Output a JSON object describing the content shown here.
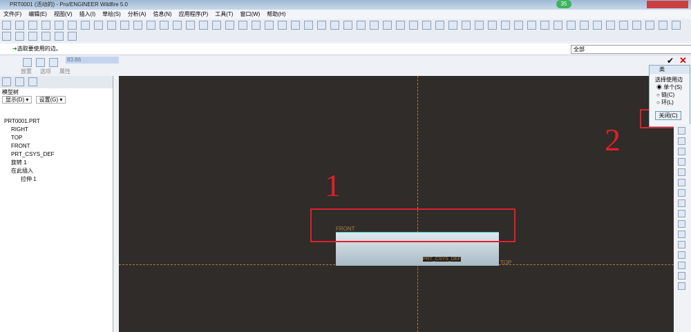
{
  "title": "PRT0001 (活动的) - Pro/ENGINEER Wildfire 5.0",
  "menu": [
    "文件(F)",
    "编辑(E)",
    "视图(V)",
    "插入(I)",
    "草绘(S)",
    "分析(A)",
    "信息(N)",
    "应用程序(P)",
    "工具(T)",
    "窗口(W)",
    "帮助(H)"
  ],
  "message": "选取要使用的边。",
  "filter": "全部",
  "dashboard": {
    "value": "83.86",
    "tabs": [
      "放置",
      "选项",
      "属性"
    ]
  },
  "model_tree": {
    "label": "模型树",
    "show": "显示(D) ▾",
    "settings": "设置(G) ▾",
    "items": [
      "PRT0001.PRT",
      "RIGHT",
      "TOP",
      "FRONT",
      "PRT_CSYS_DEF",
      "旋转 1",
      "在此插入",
      "拉伸 1"
    ]
  },
  "popup": {
    "title": "类",
    "heading": "选择使用边",
    "options": [
      "单个(S)",
      "链(C)",
      "环(L)"
    ],
    "close": "关闭(C)"
  },
  "canvas": {
    "front": "FRONT",
    "top": "TOP",
    "csys": "PRT_CSYS_DEF"
  },
  "annotations": [
    "1",
    "2"
  ],
  "badge": "35"
}
